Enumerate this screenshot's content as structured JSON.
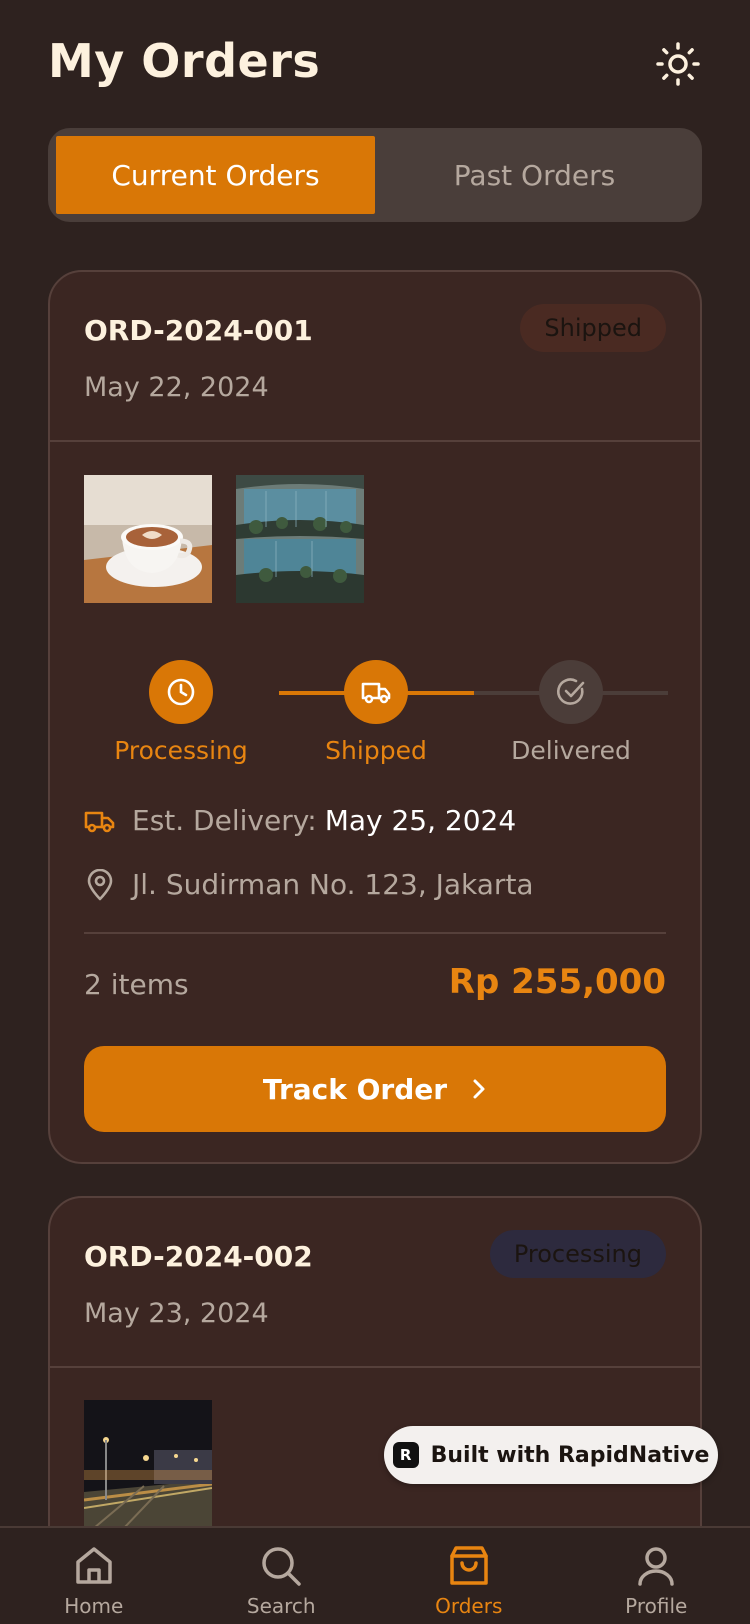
{
  "header": {
    "title": "My Orders",
    "theme_icon": "sun-icon"
  },
  "tabs": [
    {
      "label": "Current Orders",
      "active": true
    },
    {
      "label": "Past Orders",
      "active": false
    }
  ],
  "orders": [
    {
      "id": "ORD-2024-001",
      "date": "May 22, 2024",
      "status": "Shipped",
      "thumbnails": [
        "coffee-cup-photo",
        "vertical-garden-building-photo"
      ],
      "steps": [
        {
          "label": "Processing",
          "icon": "clock-icon",
          "state": "done"
        },
        {
          "label": "Shipped",
          "icon": "truck-icon",
          "state": "current"
        },
        {
          "label": "Delivered",
          "icon": "check-circle-icon",
          "state": "pending"
        }
      ],
      "est_delivery_label": "Est. Delivery:",
      "est_delivery_value": "May 25, 2024",
      "address": "Jl. Sudirman No. 123, Jakarta",
      "items": "2 items",
      "total": "Rp 255,000",
      "cta": "Track Order"
    },
    {
      "id": "ORD-2024-002",
      "date": "May 23, 2024",
      "status": "Processing",
      "thumbnails": [
        "night-city-street-photo"
      ]
    }
  ],
  "built_with": "Built with RapidNative",
  "nav": [
    {
      "label": "Home",
      "icon": "home-icon",
      "active": false
    },
    {
      "label": "Search",
      "icon": "search-icon",
      "active": false
    },
    {
      "label": "Orders",
      "icon": "shopping-bag-icon",
      "active": true
    },
    {
      "label": "Profile",
      "icon": "user-icon",
      "active": false
    }
  ],
  "colors": {
    "background": "#2e221f",
    "card": "#3b2622",
    "accent": "#d97706",
    "accent_text": "#e88511",
    "muted_text": "#b5a89e",
    "title_text": "#fdf1de"
  }
}
